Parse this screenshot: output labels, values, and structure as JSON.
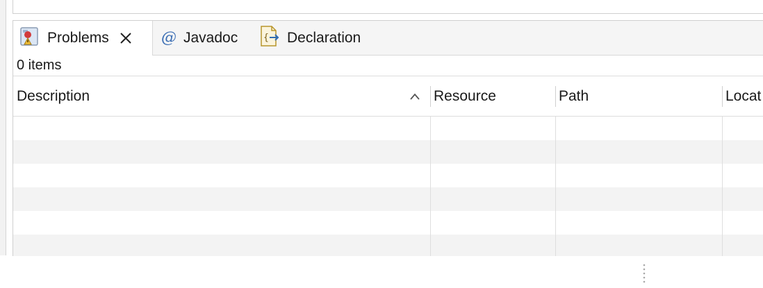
{
  "tabs": [
    {
      "label": "Problems",
      "icon": "problems-icon",
      "active": true,
      "closable": true
    },
    {
      "label": "Javadoc",
      "icon": "javadoc-at-icon",
      "active": false
    },
    {
      "label": "Declaration",
      "icon": "declaration-icon",
      "active": false
    }
  ],
  "status": {
    "item_count": "0 items"
  },
  "table": {
    "columns": [
      "Description",
      "Resource",
      "Path",
      "Locat"
    ],
    "sort_column": "Description",
    "sort_direction": "ascending",
    "rows": []
  },
  "colors": {
    "tabbar_bg": "#f5f5f5",
    "active_tab_bg": "#ffffff",
    "row_alt_bg": "#f3f3f3",
    "grid_line": "#dedede",
    "javadoc_accent": "#3b6eb4",
    "declaration_accent": "#c9a227"
  }
}
